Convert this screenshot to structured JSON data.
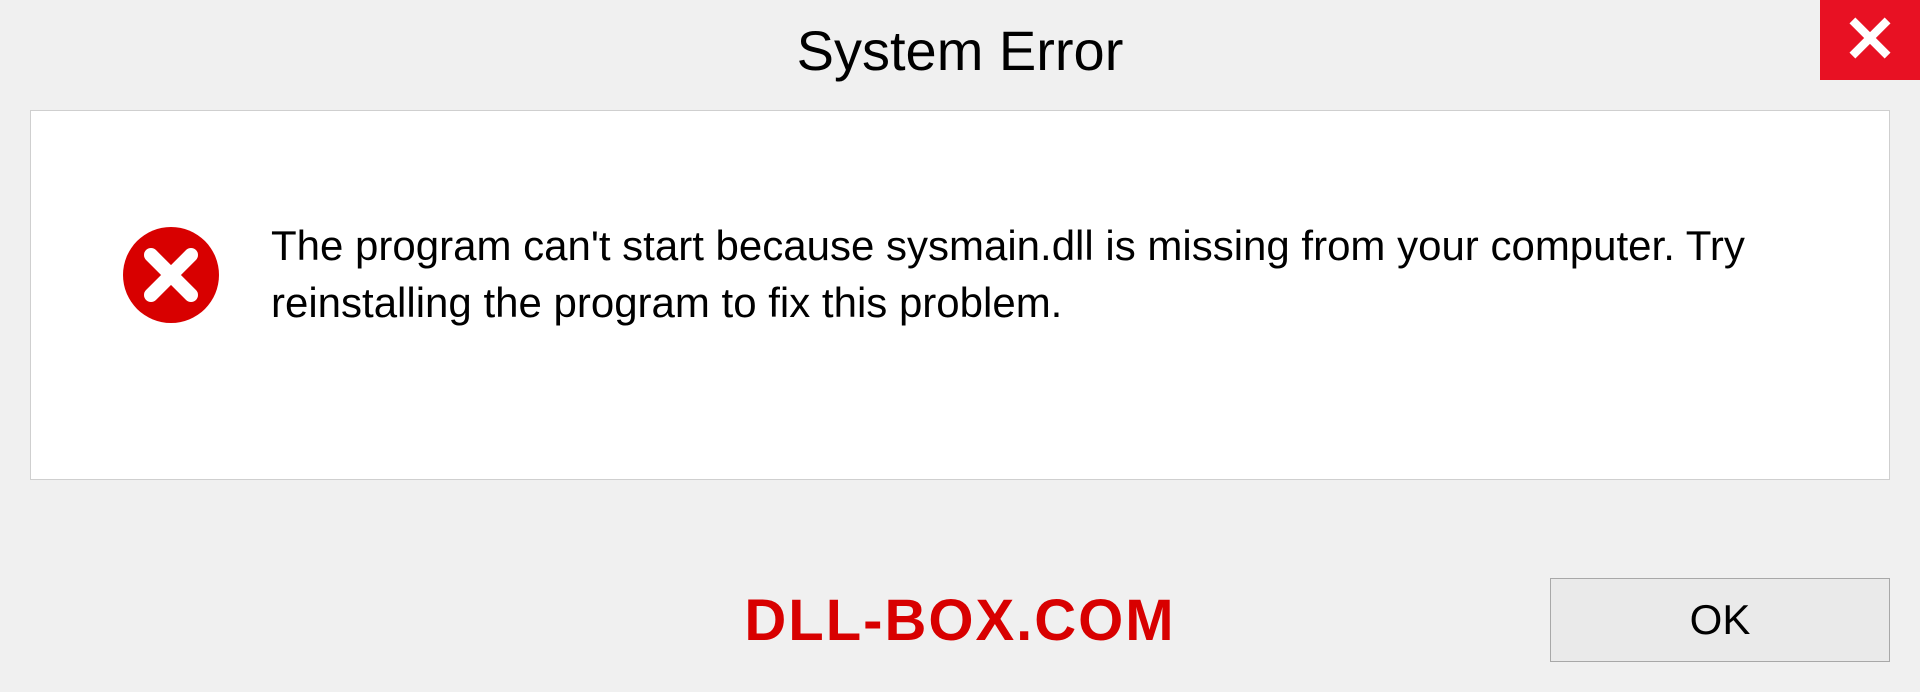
{
  "dialog": {
    "title": "System Error",
    "message": "The program can't start because sysmain.dll is missing from your computer. Try reinstalling the program to fix this problem.",
    "ok_label": "OK"
  },
  "watermark": "DLL-BOX.COM",
  "colors": {
    "close_bg": "#e81123",
    "error_icon": "#d80000",
    "watermark": "#d80000"
  }
}
